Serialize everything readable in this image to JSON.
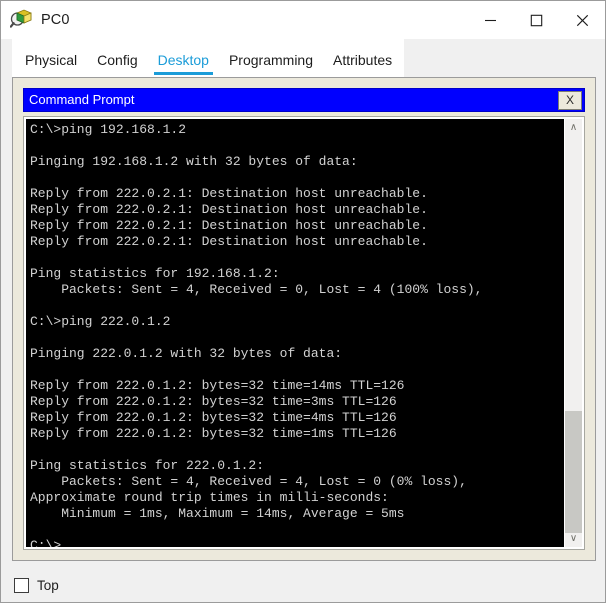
{
  "window": {
    "title": "PC0",
    "icon": "packet-tracer-icon",
    "controls": [
      {
        "name": "minimize",
        "glyph": "—"
      },
      {
        "name": "maximize",
        "glyph": "□"
      },
      {
        "name": "close",
        "glyph": "✕"
      }
    ]
  },
  "tabs": [
    {
      "label": "Physical",
      "active": false
    },
    {
      "label": "Config",
      "active": false
    },
    {
      "label": "Desktop",
      "active": true
    },
    {
      "label": "Programming",
      "active": false
    },
    {
      "label": "Attributes",
      "active": false
    }
  ],
  "command_prompt": {
    "title": "Command Prompt",
    "close_label": "X",
    "title_bg": "#0000ff",
    "text_color": "#d2d2d2",
    "background": "#000000",
    "output": "C:\\>ping 192.168.1.2\n\nPinging 192.168.1.2 with 32 bytes of data:\n\nReply from 222.0.2.1: Destination host unreachable.\nReply from 222.0.2.1: Destination host unreachable.\nReply from 222.0.2.1: Destination host unreachable.\nReply from 222.0.2.1: Destination host unreachable.\n\nPing statistics for 192.168.1.2:\n    Packets: Sent = 4, Received = 0, Lost = 4 (100% loss),\n\nC:\\>ping 222.0.1.2\n\nPinging 222.0.1.2 with 32 bytes of data:\n\nReply from 222.0.1.2: bytes=32 time=14ms TTL=126\nReply from 222.0.1.2: bytes=32 time=3ms TTL=126\nReply from 222.0.1.2: bytes=32 time=4ms TTL=126\nReply from 222.0.1.2: bytes=32 time=1ms TTL=126\n\nPing statistics for 222.0.1.2:\n    Packets: Sent = 4, Received = 4, Lost = 0 (0% loss),\nApproximate round trip times in milli-seconds:\n    Minimum = 1ms, Maximum = 14ms, Average = 5ms\n\nC:\\>"
  },
  "scrollbar": {
    "up_glyph": "∧",
    "down_glyph": "∨"
  },
  "bottom": {
    "top_label": "Top",
    "top_checked": false
  }
}
